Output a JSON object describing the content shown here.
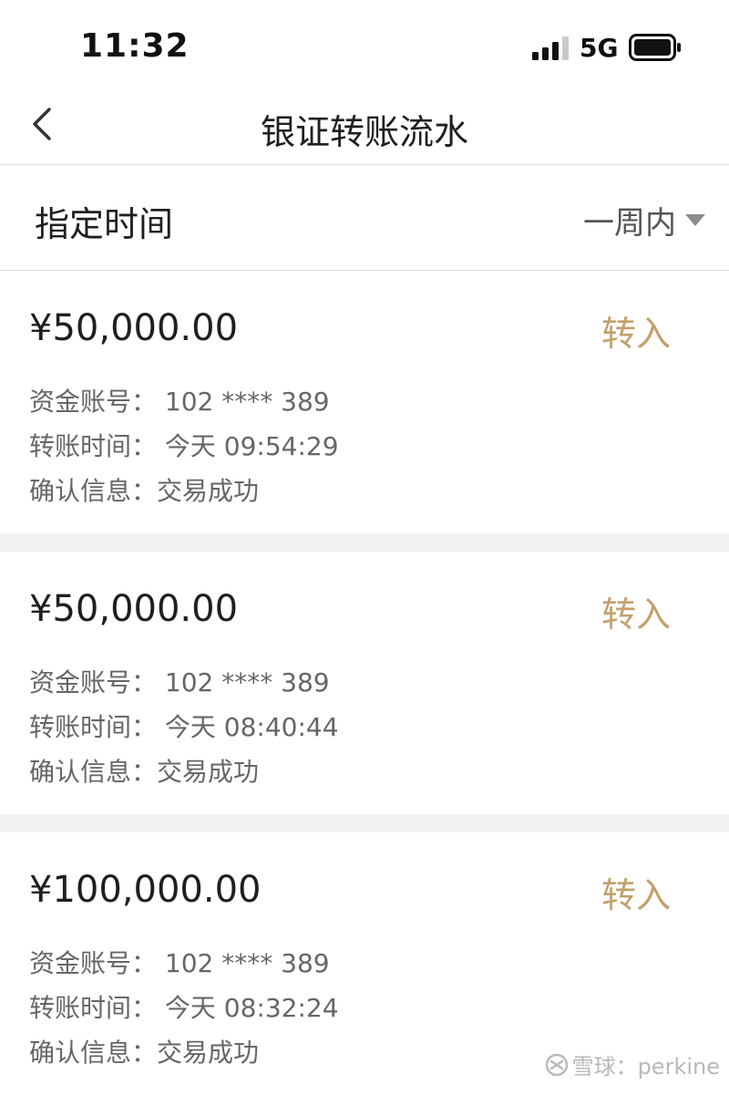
{
  "status_bar": {
    "time": "11:32",
    "network": "5G"
  },
  "nav": {
    "title": "银证转账流水"
  },
  "filter": {
    "label": "指定时间",
    "value": "一周内"
  },
  "records": [
    {
      "amount": "¥50,000.00",
      "direction": "转入",
      "account": "资金账号：  102 **** 389",
      "time": "转账时间：  今天  09:54:29",
      "status": "确认信息：交易成功"
    },
    {
      "amount": "¥50,000.00",
      "direction": "转入",
      "account": "资金账号：  102 **** 389",
      "time": "转账时间：  今天  08:40:44",
      "status": "确认信息：交易成功"
    },
    {
      "amount": "¥100,000.00",
      "direction": "转入",
      "account": "资金账号：  102 **** 389",
      "time": "转账时间：  今天  08:32:24",
      "status": "确认信息：交易成功"
    }
  ],
  "watermark": {
    "text": "雪球：perkine"
  },
  "colors": {
    "accent": "#c2a06a",
    "divider": "#dcdcdc",
    "gap": "#f2f2f4"
  }
}
